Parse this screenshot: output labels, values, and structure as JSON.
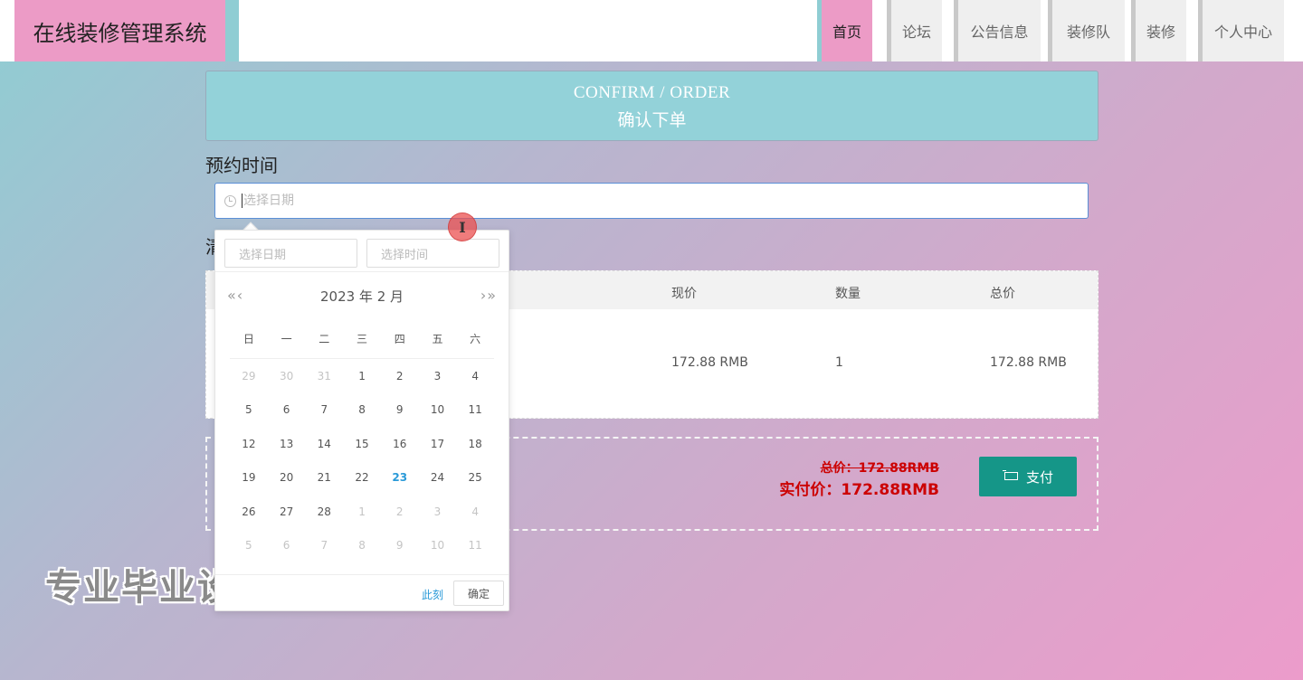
{
  "header": {
    "brand": "在线装修管理系统",
    "nav": [
      {
        "label": "首页"
      },
      {
        "label": "论坛"
      },
      {
        "label": "公告信息"
      },
      {
        "label": "装修队"
      },
      {
        "label": "装修"
      },
      {
        "label": "个人中心"
      }
    ],
    "active_color": "#ec9bc6"
  },
  "banner": {
    "en": "CONFIRM / ORDER",
    "cn": "确认下单"
  },
  "booking": {
    "label": "预约时间",
    "placeholder": "选择日期"
  },
  "list_label_char": "清",
  "table": {
    "headers": [
      "现价",
      "数量",
      "总价"
    ],
    "rows": [
      {
        "price": "172.88 RMB",
        "qty": "1",
        "total": "172.88 RMB"
      }
    ]
  },
  "payment": {
    "old_total": "总价：172.88RMB",
    "real_total": "实付价：172.88RMB",
    "pay_button": "支付",
    "pay_color": "#159688"
  },
  "picker": {
    "date_placeholder": "选择日期",
    "time_placeholder": "选择时间",
    "prev_arrows": "«‹",
    "next_arrows": "›»",
    "title": "2023 年  2 月",
    "weekdays": [
      "日",
      "一",
      "二",
      "三",
      "四",
      "五",
      "六"
    ],
    "weeks": [
      [
        {
          "d": "29",
          "dim": true
        },
        {
          "d": "30",
          "dim": true
        },
        {
          "d": "31",
          "dim": true
        },
        {
          "d": "1"
        },
        {
          "d": "2"
        },
        {
          "d": "3"
        },
        {
          "d": "4"
        }
      ],
      [
        {
          "d": "5"
        },
        {
          "d": "6"
        },
        {
          "d": "7"
        },
        {
          "d": "8"
        },
        {
          "d": "9"
        },
        {
          "d": "10"
        },
        {
          "d": "11"
        }
      ],
      [
        {
          "d": "12"
        },
        {
          "d": "13"
        },
        {
          "d": "14"
        },
        {
          "d": "15"
        },
        {
          "d": "16"
        },
        {
          "d": "17"
        },
        {
          "d": "18"
        }
      ],
      [
        {
          "d": "19"
        },
        {
          "d": "20"
        },
        {
          "d": "21"
        },
        {
          "d": "22"
        },
        {
          "d": "23",
          "today": true
        },
        {
          "d": "24"
        },
        {
          "d": "25"
        }
      ],
      [
        {
          "d": "26"
        },
        {
          "d": "27"
        },
        {
          "d": "28"
        },
        {
          "d": "1",
          "dim": true
        },
        {
          "d": "2",
          "dim": true
        },
        {
          "d": "3",
          "dim": true
        },
        {
          "d": "4",
          "dim": true
        }
      ],
      [
        {
          "d": "5",
          "dim": true
        },
        {
          "d": "6",
          "dim": true
        },
        {
          "d": "7",
          "dim": true
        },
        {
          "d": "8",
          "dim": true
        },
        {
          "d": "9",
          "dim": true
        },
        {
          "d": "10",
          "dim": true
        },
        {
          "d": "11",
          "dim": true
        }
      ]
    ],
    "now_label": "此刻",
    "ok_label": "确定",
    "today_color": "#2a9ad8"
  },
  "watermark": "专业毕业设计代做",
  "cursor_glyph": "I"
}
